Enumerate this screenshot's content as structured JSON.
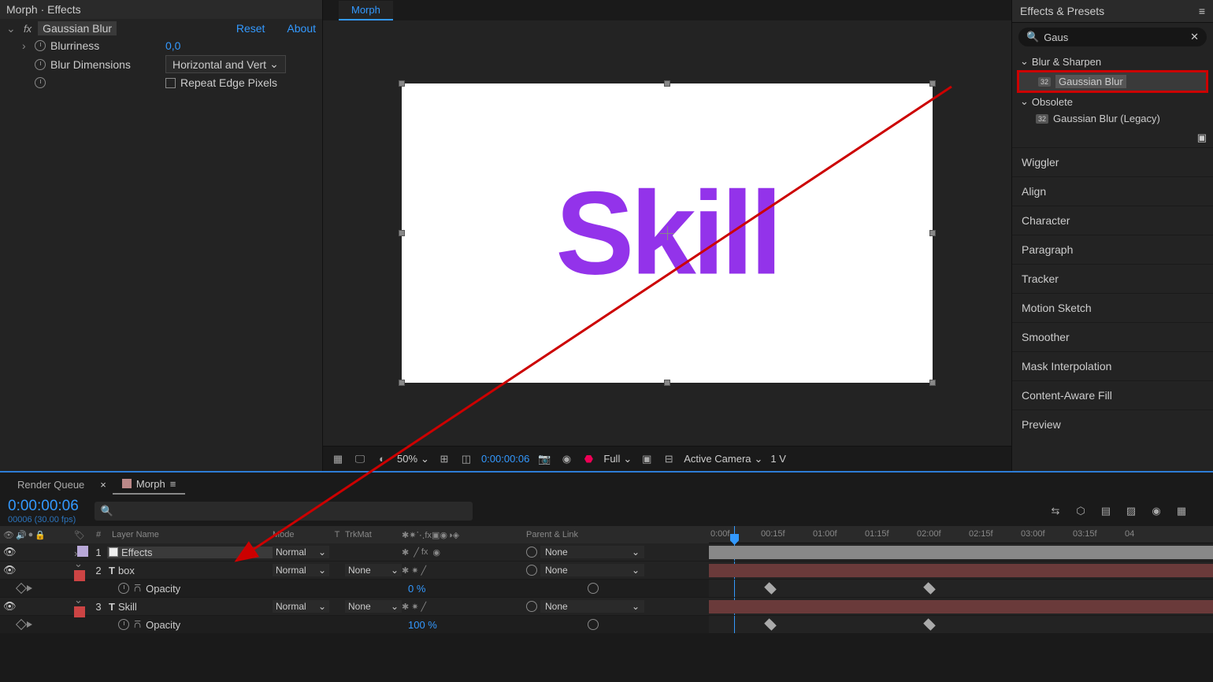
{
  "effects_panel": {
    "header": "Morph · Effects",
    "effect_name": "Gaussian Blur",
    "reset": "Reset",
    "about": "About",
    "props": {
      "blurriness": {
        "label": "Blurriness",
        "value": "0,0"
      },
      "dimensions": {
        "label": "Blur Dimensions",
        "value": "Horizontal and Vert"
      },
      "repeat": {
        "label": "Repeat Edge Pixels"
      }
    }
  },
  "composition": {
    "tab": "Morph",
    "canvas_text": "Skill",
    "controls": {
      "zoom": "50%",
      "time": "0:00:00:06",
      "resolution": "Full",
      "camera": "Active Camera",
      "view": "1 V"
    }
  },
  "effects_presets": {
    "title": "Effects & Presets",
    "search": "Gaus",
    "groups": {
      "blur_sharpen": "Blur & Sharpen",
      "gaussian": "Gaussian Blur",
      "obsolete": "Obsolete",
      "legacy": "Gaussian Blur (Legacy)"
    },
    "panels": [
      "Wiggler",
      "Align",
      "Character",
      "Paragraph",
      "Tracker",
      "Motion Sketch",
      "Smoother",
      "Mask Interpolation",
      "Content-Aware Fill",
      "Preview"
    ]
  },
  "timeline": {
    "render_queue": "Render Queue",
    "comp_name": "Morph",
    "timecode": "0:00:00:06",
    "timecode_sub": "00006 (30.00 fps)",
    "headers": {
      "num": "#",
      "layer_name": "Layer Name",
      "mode": "Mode",
      "t": "T",
      "trkmat": "TrkMat",
      "parent": "Parent & Link"
    },
    "layers": [
      {
        "num": "1",
        "name": "Effects",
        "color": "#b8a8d8",
        "mode": "Normal",
        "trkmat": "",
        "parent": "None",
        "icon": "solid"
      },
      {
        "num": "2",
        "name": "box",
        "color": "#cc4444",
        "mode": "Normal",
        "trkmat": "None",
        "parent": "None",
        "icon": "text"
      },
      {
        "num": "3",
        "name": "Skill",
        "color": "#cc4444",
        "mode": "Normal",
        "trkmat": "None",
        "parent": "None",
        "icon": "text"
      }
    ],
    "opacity_label": "Opacity",
    "opacity_values": [
      "0 %",
      "100 %"
    ],
    "ruler": [
      "0:00f",
      "00:15f",
      "01:00f",
      "01:15f",
      "02:00f",
      "02:15f",
      "03:00f",
      "03:15f",
      "04"
    ]
  }
}
